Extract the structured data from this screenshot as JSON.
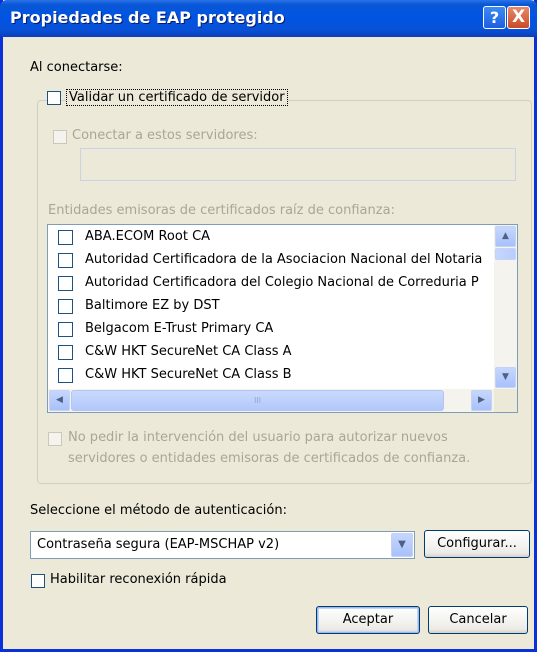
{
  "window": {
    "title": "Propiedades de EAP protegido",
    "help_button": "?",
    "close_button": "X"
  },
  "on_connect_label": "Al conectarse:",
  "validate_cert": {
    "label": "Validar un certificado de servidor",
    "checked": false
  },
  "connect_servers": {
    "label": "Conectar a estos servidores:",
    "checked": false,
    "value": ""
  },
  "trusted_ca": {
    "label": "Entidades emisoras de certificados raíz de confianza:",
    "items": [
      {
        "label": "ABA.ECOM Root CA",
        "checked": false
      },
      {
        "label": "Autoridad Certificadora de la Asociacion Nacional del Notaria",
        "checked": false
      },
      {
        "label": "Autoridad Certificadora del Colegio Nacional de Correduria P",
        "checked": false
      },
      {
        "label": "Baltimore EZ by DST",
        "checked": false
      },
      {
        "label": "Belgacom E-Trust Primary CA",
        "checked": false
      },
      {
        "label": "C&W HKT SecureNet CA Class A",
        "checked": false
      },
      {
        "label": "C&W HKT SecureNet CA Class B",
        "checked": false
      }
    ],
    "hscroll_grip": "III"
  },
  "no_prompt": {
    "label_line1": "No pedir la intervención del usuario para autorizar nuevos",
    "label_line2": "servidores o entidades emisoras de certificados de confianza.",
    "checked": false
  },
  "auth_method": {
    "label": "Seleccione el método de autenticación:",
    "selected": "Contraseña segura (EAP-MSCHAP v2)",
    "configure_label": "Configurar..."
  },
  "fast_reconnect": {
    "label": "Habilitar reconexión rápida",
    "checked": false
  },
  "buttons": {
    "ok": "Aceptar",
    "cancel": "Cancelar"
  }
}
